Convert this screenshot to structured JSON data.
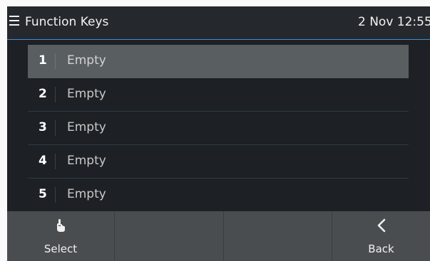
{
  "header": {
    "title": "Function Keys",
    "clock": "2 Nov 12:55"
  },
  "list": {
    "items": [
      {
        "number": "1",
        "label": "Empty",
        "selected": true
      },
      {
        "number": "2",
        "label": "Empty",
        "selected": false
      },
      {
        "number": "3",
        "label": "Empty",
        "selected": false
      },
      {
        "number": "4",
        "label": "Empty",
        "selected": false
      },
      {
        "number": "5",
        "label": "Empty",
        "selected": false
      }
    ]
  },
  "softkeys": [
    {
      "label": "Select",
      "icon": "hand-pointer-icon"
    },
    {
      "label": "",
      "icon": ""
    },
    {
      "label": "",
      "icon": ""
    },
    {
      "label": "Back",
      "icon": "chevron-left-icon"
    }
  ]
}
